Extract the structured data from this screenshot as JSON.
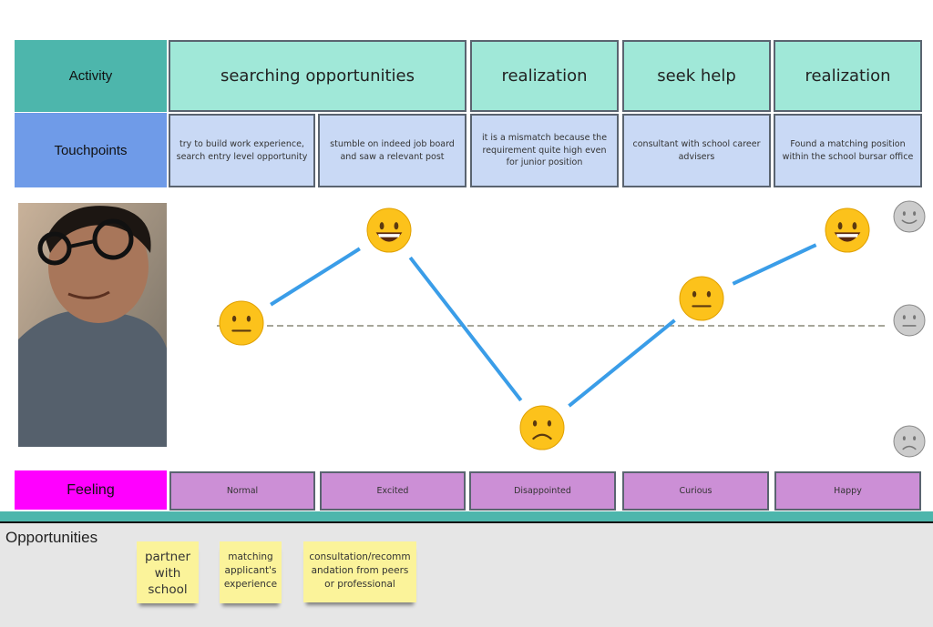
{
  "activity": {
    "label": "Activity",
    "items": [
      "searching opportunities",
      "realization",
      "seek help",
      "realization"
    ]
  },
  "touchpoints": {
    "label": "Touchpoints",
    "items": [
      "try to build work experience, search entry level opportunity",
      "stumble on indeed job board and saw a relevant post",
      "it is a mismatch because the requirement quite high even for junior position",
      "consultant with school career advisers",
      "Found a matching position within the school bursar office"
    ]
  },
  "feeling": {
    "label": "Feeling",
    "items": [
      "Normal",
      "Excited",
      "Disappointed",
      "Curious",
      "Happy"
    ],
    "levels": [
      "neutral",
      "happy",
      "sad",
      "neutral",
      "happy"
    ]
  },
  "scale_icons": [
    "smile-icon",
    "neutral-icon",
    "frown-icon"
  ],
  "opportunities": {
    "label": "Opportunities",
    "notes": [
      "partner with school",
      "matching applicant's experience",
      "consultation/recommandation from peers or professional"
    ]
  },
  "colors": {
    "activity_header": "#4db6ac",
    "activity": "#a0e8d8",
    "touchpoint_header": "#6f9be8",
    "touchpoint": "#c9d9f5",
    "feeling_header": "#ff00ff",
    "feeling": "#cc8fd6",
    "curve": "#3a9de8",
    "sticky": "#fbf39a"
  }
}
